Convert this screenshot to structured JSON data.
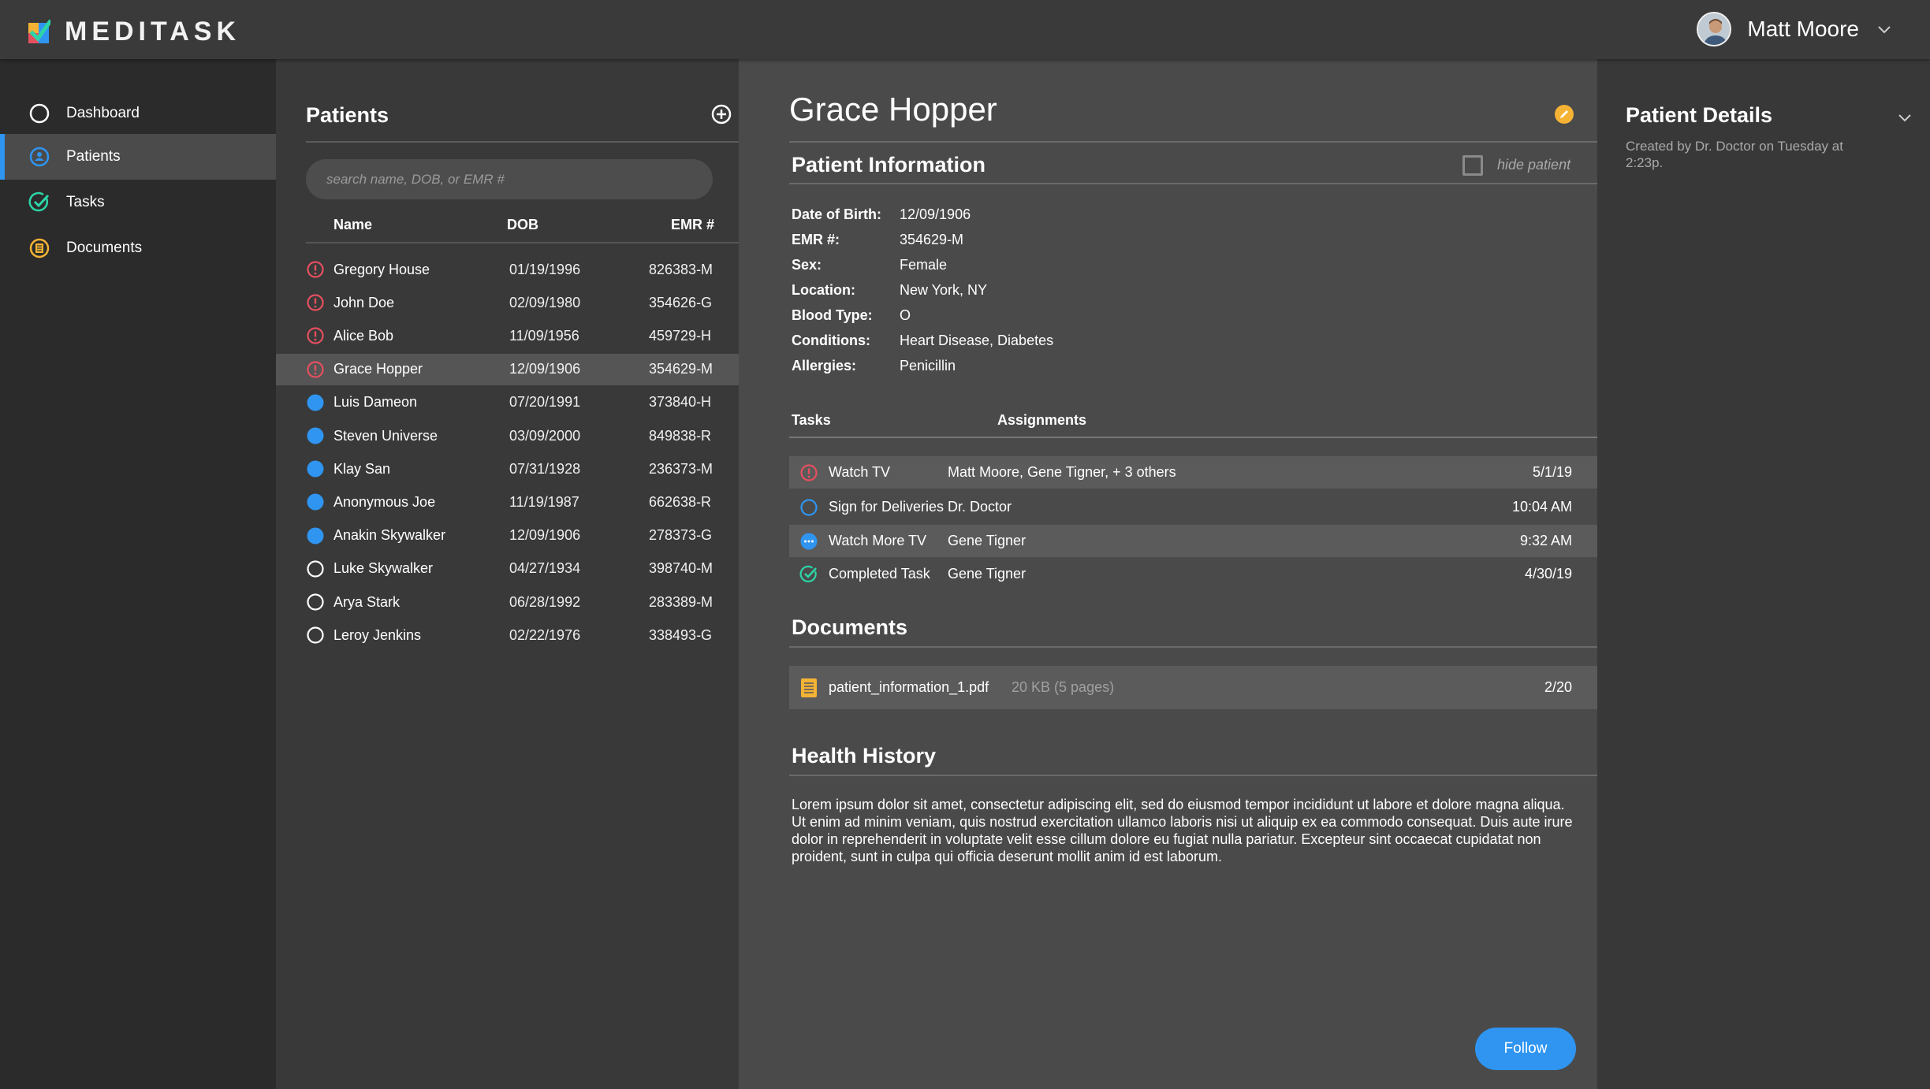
{
  "app": {
    "name": "MEDITASK"
  },
  "user": {
    "name": "Matt Moore"
  },
  "nav": {
    "items": [
      {
        "label": "Dashboard",
        "icon": "circle-icon",
        "color": "#ffffff"
      },
      {
        "label": "Patients",
        "icon": "patients-icon",
        "color": "#2f95f1"
      },
      {
        "label": "Tasks",
        "icon": "check-circle-icon",
        "color": "#2dd4a7"
      },
      {
        "label": "Documents",
        "icon": "document-icon",
        "color": "#f5b335"
      }
    ]
  },
  "patients": {
    "title": "Patients",
    "search_placeholder": "search name, DOB, or EMR #",
    "columns": {
      "name": "Name",
      "dob": "DOB",
      "emr": "EMR #"
    },
    "rows": [
      {
        "status": "alert",
        "name": "Gregory House",
        "dob": "01/19/1996",
        "emr": "826383-M"
      },
      {
        "status": "alert",
        "name": "John Doe",
        "dob": "02/09/1980",
        "emr": "354626-G"
      },
      {
        "status": "alert",
        "name": "Alice Bob",
        "dob": "11/09/1956",
        "emr": "459729-H"
      },
      {
        "status": "alert",
        "name": "Grace Hopper",
        "dob": "12/09/1906",
        "emr": "354629-M"
      },
      {
        "status": "active",
        "name": "Luis Dameon",
        "dob": "07/20/1991",
        "emr": "373840-H"
      },
      {
        "status": "active",
        "name": "Steven Universe",
        "dob": "03/09/2000",
        "emr": "849838-R"
      },
      {
        "status": "active",
        "name": "Klay San",
        "dob": "07/31/1928",
        "emr": "236373-M"
      },
      {
        "status": "active",
        "name": "Anonymous Joe",
        "dob": "11/19/1987",
        "emr": "662638-R"
      },
      {
        "status": "active",
        "name": "Anakin Skywalker",
        "dob": "12/09/1906",
        "emr": "278373-G"
      },
      {
        "status": "none",
        "name": "Luke Skywalker",
        "dob": "04/27/1934",
        "emr": "398740-M"
      },
      {
        "status": "none",
        "name": "Arya Stark",
        "dob": "06/28/1992",
        "emr": "283389-M"
      },
      {
        "status": "none",
        "name": "Leroy Jenkins",
        "dob": "02/22/1976",
        "emr": "338493-G"
      }
    ]
  },
  "patient": {
    "name": "Grace Hopper",
    "info_title": "Patient Information",
    "hide_label": "hide patient",
    "info": [
      {
        "label": "Date of Birth:",
        "value": "12/09/1906"
      },
      {
        "label": "EMR #:",
        "value": "354629-M"
      },
      {
        "label": "Sex:",
        "value": "Female"
      },
      {
        "label": "Location:",
        "value": "New York, NY"
      },
      {
        "label": "Blood Type:",
        "value": "O"
      },
      {
        "label": "Conditions:",
        "value": "Heart Disease, Diabetes"
      },
      {
        "label": "Allergies:",
        "value": "Penicillin"
      }
    ],
    "tasks_header": "Tasks",
    "assignments_header": "Assignments",
    "tasks": [
      {
        "status": "alert",
        "name": "Watch TV",
        "assignments": "Matt Moore, Gene Tigner, + 3 others",
        "time": "5/1/19"
      },
      {
        "status": "open",
        "name": "Sign for Deliveries",
        "assignments": "Dr. Doctor",
        "time": "10:04 AM"
      },
      {
        "status": "in-progress",
        "name": "Watch More TV",
        "assignments": "Gene Tigner",
        "time": "9:32 AM"
      },
      {
        "status": "done",
        "name": "Completed Task",
        "assignments": "Gene Tigner",
        "time": "4/30/19"
      }
    ],
    "documents_title": "Documents",
    "document": {
      "name": "patient_information_1.pdf",
      "size": "20 KB (5 pages)",
      "date": "2/20"
    },
    "history_title": "Health History",
    "history_text": "Lorem ipsum dolor sit amet, consectetur adipiscing elit, sed do eiusmod tempor incididunt ut labore et dolore magna aliqua. Ut enim ad minim veniam, quis nostrud exercitation ullamco laboris nisi ut aliquip ex ea commodo consequat. Duis aute irure dolor in reprehenderit in voluptate velit esse cillum dolore eu fugiat nulla pariatur. Excepteur sint occaecat cupidatat non proident, sunt in culpa qui officia deserunt mollit anim id est laborum.",
    "follow_label": "Follow"
  },
  "details": {
    "title": "Patient Details",
    "created": "Created by Dr. Doctor on Tuesday at 2:23p."
  },
  "colors": {
    "accent": "#2f95f1",
    "alert": "#e5505f",
    "success": "#2dd4a7",
    "warning": "#f5b335"
  }
}
